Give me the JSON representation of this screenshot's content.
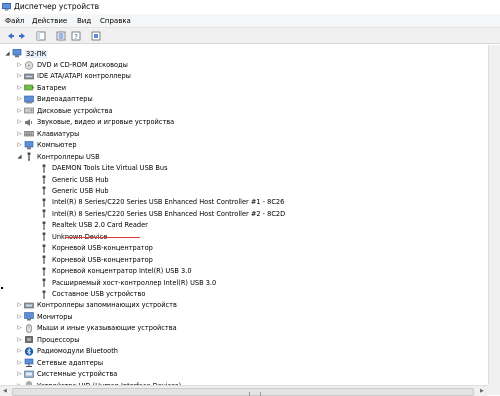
{
  "window": {
    "title": "Диспетчер устройств",
    "icon": "device-manager-icon"
  },
  "menu": [
    "Файл",
    "Действие",
    "Вид",
    "Справка"
  ],
  "toolbar": [
    {
      "name": "back-icon",
      "glyph": "back"
    },
    {
      "name": "forward-icon",
      "glyph": "forward"
    },
    {
      "name": "show-hide-tree-icon",
      "glyph": "tree"
    },
    {
      "name": "properties-icon",
      "glyph": "props"
    },
    {
      "name": "help-icon",
      "glyph": "help"
    },
    {
      "name": "device-view-icon",
      "glyph": "view"
    }
  ],
  "tree": {
    "root": "32-ПК",
    "items": [
      {
        "label": "DVD и CD-ROM дисководы",
        "icon": "dvd-drive-icon",
        "level": 1,
        "expander": "collapsed"
      },
      {
        "label": "IDE ATA/ATAPI контроллеры",
        "icon": "ide-controller-icon",
        "level": 1,
        "expander": "collapsed"
      },
      {
        "label": "Батареи",
        "icon": "battery-icon",
        "level": 1,
        "expander": "collapsed"
      },
      {
        "label": "Видеоадаптеры",
        "icon": "display-adapter-icon",
        "level": 1,
        "expander": "collapsed"
      },
      {
        "label": "Дисковые устройства",
        "icon": "disk-drive-icon",
        "level": 1,
        "expander": "collapsed"
      },
      {
        "label": "Звуковые, видео и игровые устройства",
        "icon": "sound-device-icon",
        "level": 1,
        "expander": "collapsed"
      },
      {
        "label": "Клавиатуры",
        "icon": "keyboard-icon",
        "level": 1,
        "expander": "collapsed"
      },
      {
        "label": "Компьютер",
        "icon": "computer-icon",
        "level": 1,
        "expander": "collapsed"
      },
      {
        "label": "Контроллеры USB",
        "icon": "usb-controller-icon",
        "level": 1,
        "expander": "expanded"
      },
      {
        "label": "DAEMON Tools Lite Virtual USB Bus",
        "icon": "usb-plug-icon",
        "level": 2
      },
      {
        "label": "Generic USB Hub",
        "icon": "usb-plug-icon",
        "level": 2
      },
      {
        "label": "Generic USB Hub",
        "icon": "usb-plug-icon",
        "level": 2
      },
      {
        "label": "Intel(R) 8 Series/C220 Series USB Enhanced Host Controller #1 - 8C26",
        "icon": "usb-plug-icon",
        "level": 2
      },
      {
        "label": "Intel(R) 8 Series/C220 Series USB Enhanced Host Controller #2 - 8C2D",
        "icon": "usb-plug-icon",
        "level": 2
      },
      {
        "label": "Realtek USB 2.0 Card Reader",
        "icon": "usb-plug-icon",
        "level": 2
      },
      {
        "label": "Unknown Device",
        "icon": "usb-plug-icon",
        "level": 2
      },
      {
        "label": "Корневой USB-концентратор",
        "icon": "usb-plug-icon",
        "level": 2
      },
      {
        "label": "Корневой USB-концентратор",
        "icon": "usb-plug-icon",
        "level": 2
      },
      {
        "label": "Корневой концентратор Intel(R) USB 3.0",
        "icon": "usb-plug-icon",
        "level": 2
      },
      {
        "label": "Расширяемый хост-контроллер Intel(R) USB 3.0",
        "icon": "usb-plug-icon",
        "level": 2
      },
      {
        "label": "Составное USB устройство",
        "icon": "usb-plug-icon",
        "level": 2
      },
      {
        "label": "Контроллеры запоминающих устройств",
        "icon": "storage-controller-icon",
        "level": 1,
        "expander": "collapsed"
      },
      {
        "label": "Мониторы",
        "icon": "monitor-icon",
        "level": 1,
        "expander": "collapsed"
      },
      {
        "label": "Мыши и иные указывающие устройства",
        "icon": "mouse-icon",
        "level": 1,
        "expander": "collapsed"
      },
      {
        "label": "Процессоры",
        "icon": "processor-icon",
        "level": 1,
        "expander": "collapsed"
      },
      {
        "label": "Радиомодули Bluetooth",
        "icon": "bluetooth-icon",
        "level": 1,
        "expander": "collapsed"
      },
      {
        "label": "Сетевые адаптеры",
        "icon": "network-adapter-icon",
        "level": 1,
        "expander": "collapsed"
      },
      {
        "label": "Системные устройства",
        "icon": "system-device-icon",
        "level": 1,
        "expander": "collapsed"
      },
      {
        "label": "Устройства HID (Human Interface Devices)",
        "icon": "hid-icon",
        "level": 1,
        "expander": "collapsed"
      }
    ]
  },
  "colors": {
    "selection": "#cfe5fa",
    "annotation_underline": "#e53935"
  }
}
